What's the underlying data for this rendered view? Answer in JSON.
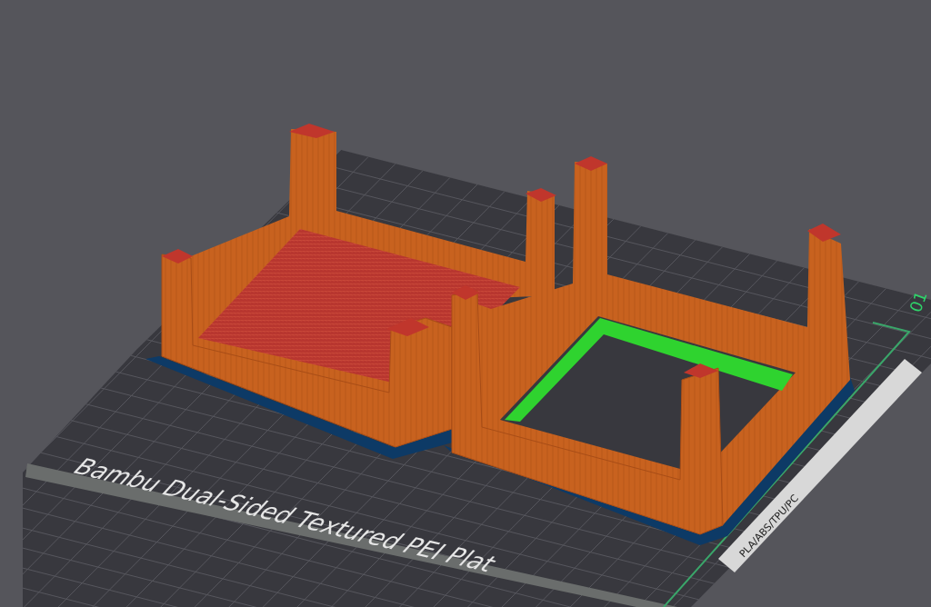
{
  "viewport": {
    "plate_label": "Bambu Dual-Sided Textured PEI Plat",
    "filament_label": "PLA/ABS/TPU/PC",
    "plate_number": "01"
  }
}
